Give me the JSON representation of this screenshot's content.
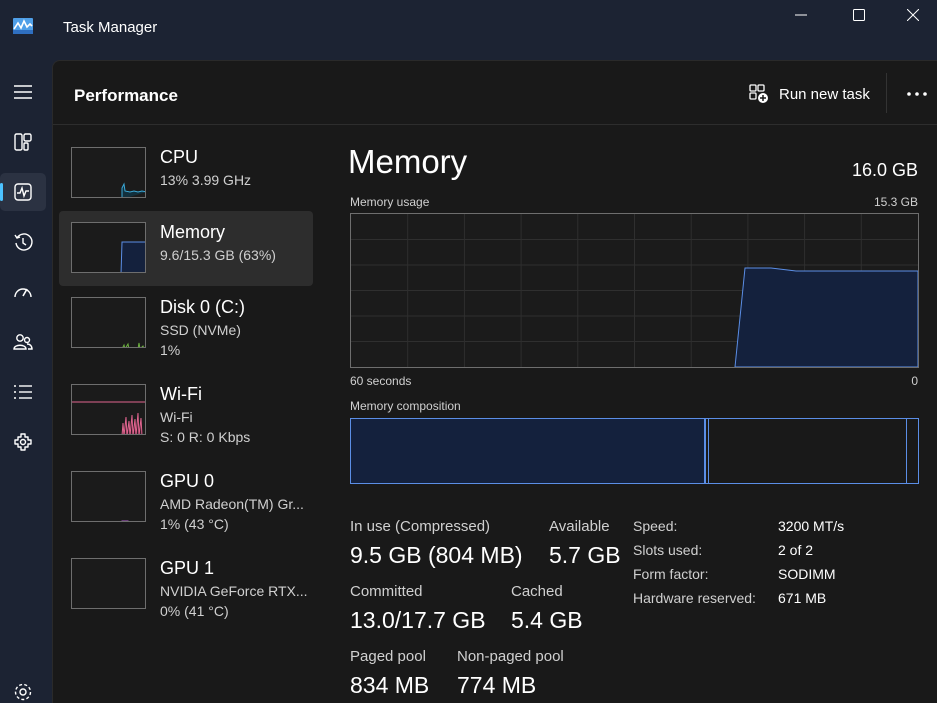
{
  "window": {
    "title": "Task Manager"
  },
  "header": {
    "page_title": "Performance",
    "run_new_task": "Run new task"
  },
  "nav": {
    "items": [
      "menu-icon",
      "processes-icon",
      "performance-icon",
      "app-history-icon",
      "startup-apps-icon",
      "users-icon",
      "details-icon",
      "services-icon",
      "settings-icon"
    ],
    "active": "performance-icon"
  },
  "perf_list": [
    {
      "name": "CPU",
      "sub1": "13%  3.99 GHz",
      "sub2": ""
    },
    {
      "name": "Memory",
      "sub1": "9.6/15.3 GB (63%)",
      "sub2": ""
    },
    {
      "name": "Disk 0 (C:)",
      "sub1": "SSD (NVMe)",
      "sub2": "1%"
    },
    {
      "name": "Wi-Fi",
      "sub1": "Wi-Fi",
      "sub2": "S: 0  R: 0 Kbps"
    },
    {
      "name": "GPU 0",
      "sub1": "AMD Radeon(TM) Gr...",
      "sub2": "1%  (43 °C)"
    },
    {
      "name": "GPU 1",
      "sub1": "NVIDIA GeForce RTX...",
      "sub2": "0%  (41 °C)"
    }
  ],
  "detail": {
    "title": "Memory",
    "total": "16.0 GB",
    "usage_label": "Memory usage",
    "usage_max": "15.3 GB",
    "time_left": "60 seconds",
    "time_right": "0",
    "composition_label": "Memory composition",
    "stats": {
      "in_use_label": "In use (Compressed)",
      "in_use_value": "9.5 GB (804 MB)",
      "available_label": "Available",
      "available_value": "5.7 GB",
      "committed_label": "Committed",
      "committed_value": "13.0/17.7 GB",
      "cached_label": "Cached",
      "cached_value": "5.4 GB",
      "paged_pool_label": "Paged pool",
      "paged_pool_value": "834 MB",
      "non_paged_pool_label": "Non-paged pool",
      "non_paged_pool_value": "774 MB"
    },
    "properties": [
      {
        "label": "Speed:",
        "value": "3200 MT/s"
      },
      {
        "label": "Slots used:",
        "value": "2 of 2"
      },
      {
        "label": "Form factor:",
        "value": "SODIMM"
      },
      {
        "label": "Hardware reserved:",
        "value": "671 MB"
      }
    ]
  },
  "colors": {
    "accent": "#4cc2ff",
    "memory_line": "#5b8ee6",
    "memory_fill": "#14213d",
    "cpu_line": "#3aa9d8",
    "disk_line": "#6db33f",
    "wifi_line": "#e0648f",
    "gpu_line": "#b05fd0"
  }
}
